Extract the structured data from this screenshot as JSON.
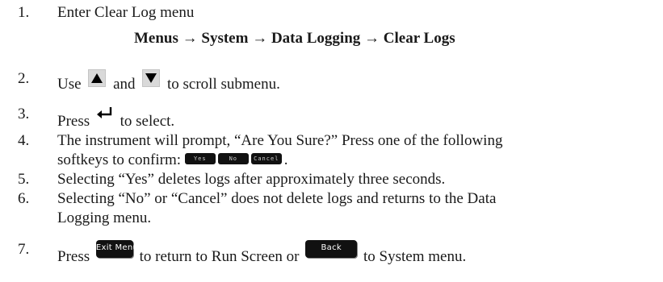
{
  "steps": [
    {
      "num": "1.",
      "text": "Enter Clear Log menu",
      "path": "Menus → System → Data Logging → Clear Logs"
    },
    {
      "num": "2.",
      "pre": "Use",
      "mid": "and",
      "post": "to scroll submenu."
    },
    {
      "num": "3.",
      "pre": "Press",
      "post": "to select."
    },
    {
      "num": "4.",
      "line1": "The instrument will prompt, “Are You Sure?” Press one of the following",
      "line2_pre": "softkeys to confirm:",
      "line2_post": "."
    },
    {
      "num": "5.",
      "text": "Selecting “Yes” deletes logs after approximately three seconds."
    },
    {
      "num": "6.",
      "line1": "Selecting “No” or “Cancel” does not delete logs and returns to the Data",
      "line2": "Logging menu."
    },
    {
      "num": "7.",
      "pre": "Press",
      "mid": "to return to Run Screen or",
      "post": "to System menu."
    }
  ],
  "softkeys": [
    "Yes",
    "No",
    "Cancel"
  ],
  "buttons": {
    "exit_menu": "Exit Menu",
    "back": "Back"
  },
  "icons": {
    "up": "up-arrow-icon",
    "down": "down-arrow-icon",
    "enter": "enter-icon"
  }
}
